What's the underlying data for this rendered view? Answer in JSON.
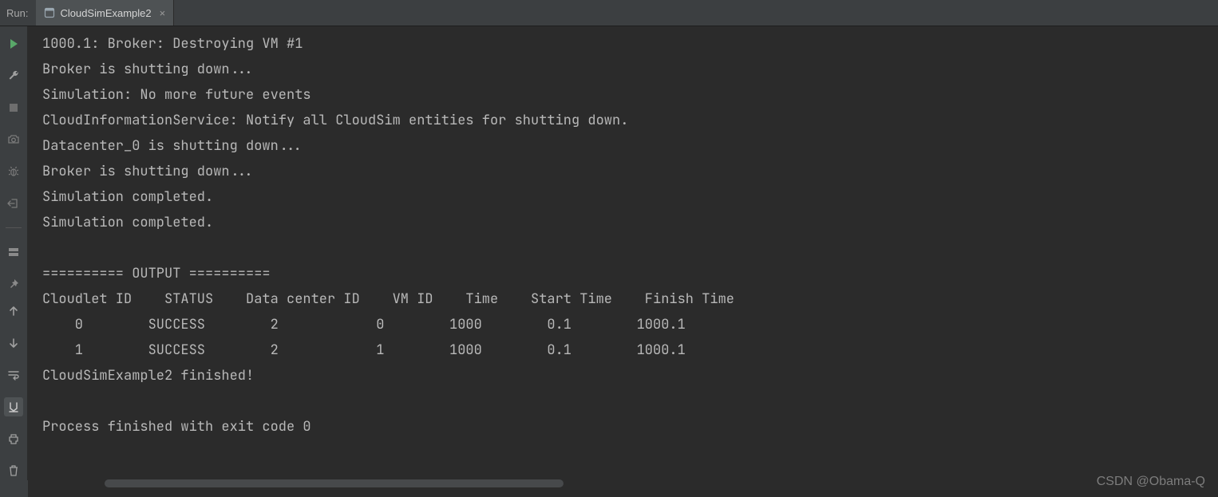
{
  "header": {
    "run_label": "Run:",
    "tab": {
      "title": "CloudSimExample2",
      "close_glyph": "×"
    }
  },
  "toolbar_left": {
    "run": "run-icon",
    "wrench": "wrench-icon",
    "stop": "stop-icon",
    "camera": "camera-icon",
    "bug": "bug-icon",
    "exit": "exit-icon",
    "layout": "layout-icon",
    "pin": "pin-icon"
  },
  "toolbar_right": {
    "up": "arrow-up-icon",
    "down": "arrow-down-icon",
    "wrap": "soft-wrap-icon",
    "scroll": "scroll-to-end-icon",
    "print": "print-icon",
    "trash": "trash-icon"
  },
  "console": {
    "lines": [
      "1000.1: Broker: Destroying VM #1",
      "Broker is shutting down...",
      "Simulation: No more future events",
      "CloudInformationService: Notify all CloudSim entities for shutting down.",
      "Datacenter_0 is shutting down...",
      "Broker is shutting down...",
      "Simulation completed.",
      "Simulation completed.",
      "",
      "========== OUTPUT ==========",
      "Cloudlet ID    STATUS    Data center ID    VM ID    Time    Start Time    Finish Time",
      "    0        SUCCESS        2            0        1000        0.1        1000.1",
      "    1        SUCCESS        2            1        1000        0.1        1000.1",
      "CloudSimExample2 finished!",
      "",
      "Process finished with exit code 0"
    ]
  },
  "watermark": "CSDN @Obama-Q"
}
